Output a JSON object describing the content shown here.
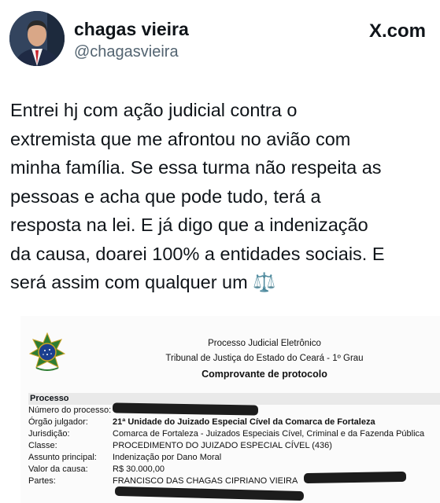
{
  "tweet": {
    "author_name": "chagas vieira",
    "author_handle": "@chagasvieira",
    "platform": "X.com",
    "text": "Entrei hj com ação judicial contra o\nextremista que me afrontou no avião com\nminha família. Se essa turma não respeita as\npessoas e acha que pode tudo, terá a\nresposta na lei. E já digo que a indenização\nda causa, doarei 100% a entidades sociais. E\nserá assim com qualquer um ⚖️"
  },
  "document": {
    "header_line1": "Processo Judicial Eletrônico",
    "header_line2": "Tribunal de Justiça do Estado do Ceará - 1º Grau",
    "header_title": "Comprovante de protocolo",
    "section_title": "Processo",
    "fields": [
      {
        "label": "Número do processo:",
        "value": ""
      },
      {
        "label": "Órgão julgador:",
        "value": "21ª Unidade do Juizado Especial Cível da Comarca de Fortaleza"
      },
      {
        "label": "Jurisdição:",
        "value": "Comarca de Fortaleza - Juizados Especiais Cível, Criminal e da Fazenda Pública"
      },
      {
        "label": "Classe:",
        "value": "PROCEDIMENTO DO JUIZADO ESPECIAL CÍVEL (436)"
      },
      {
        "label": "Assunto principal:",
        "value": "Indenização por Dano Moral"
      },
      {
        "label": "Valor da causa:",
        "value": "R$ 30.000,00"
      },
      {
        "label": "Partes:",
        "value": "FRANCISCO DAS CHAGAS CIPRIANO VIEIRA"
      }
    ]
  }
}
